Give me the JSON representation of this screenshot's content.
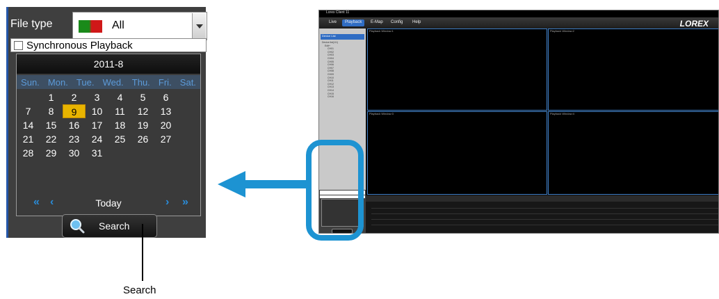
{
  "zoom_panel": {
    "file_type_label": "File type",
    "file_type_value": "All",
    "sync_label": "Synchronous Playback",
    "calendar": {
      "month": "2011-8",
      "weekdays": [
        "Sun.",
        "Mon.",
        "Tue.",
        "Wed.",
        "Thu.",
        "Fri.",
        "Sat."
      ],
      "weeks": [
        [
          "",
          "1",
          "2",
          "3",
          "4",
          "5",
          "6"
        ],
        [
          "7",
          "8",
          "9",
          "10",
          "11",
          "12",
          "13"
        ],
        [
          "14",
          "15",
          "16",
          "17",
          "18",
          "19",
          "20"
        ],
        [
          "21",
          "22",
          "23",
          "24",
          "25",
          "26",
          "27"
        ],
        [
          "28",
          "29",
          "30",
          "31",
          "",
          "",
          ""
        ]
      ],
      "selected_day": "9",
      "nav": {
        "first": "«",
        "prev": "‹",
        "today": "Today",
        "next": "›",
        "last": "»"
      }
    },
    "search_label": "Search"
  },
  "caption": "Search",
  "app": {
    "title": "Lorex Client 11",
    "menu": [
      "Live",
      "Playback",
      "E-Map",
      "Config",
      "Help"
    ],
    "active_menu": "Playback",
    "logo": "LOREX",
    "device_header": "Device List",
    "device_tree": [
      "Device list(1/1)",
      "Edit+",
      "CH01",
      "CH02",
      "CH03",
      "CH04",
      "CH05",
      "CH06",
      "CH07",
      "CH08",
      "CH09",
      "CH10",
      "CH11",
      "CH12",
      "CH13",
      "CH14",
      "CH15",
      "CH16"
    ],
    "windows": [
      "Playback Window:1",
      "Playback Window:2",
      "Playback Window:3",
      "Playback Window:4"
    ]
  },
  "colors": {
    "accent_blue": "#1d93d2",
    "selected_day": "#e8b400",
    "weekday_text": "#5c9ad8"
  },
  "icons": [
    "search-icon",
    "chevron-down-icon",
    "double-left-icon",
    "left-icon",
    "right-icon",
    "double-right-icon",
    "arrow-left-icon"
  ]
}
